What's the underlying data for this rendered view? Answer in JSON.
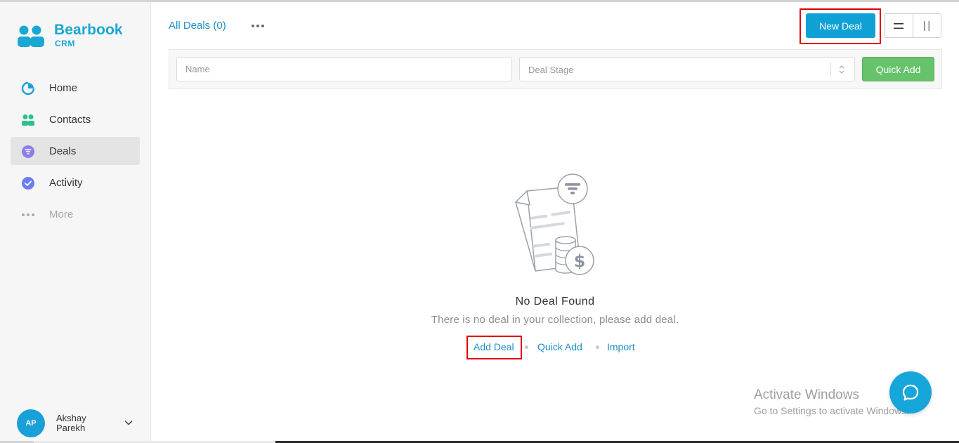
{
  "brand": {
    "name": "Bearbook",
    "sub": "CRM"
  },
  "sidebar": {
    "items": [
      {
        "label": "Home"
      },
      {
        "label": "Contacts"
      },
      {
        "label": "Deals"
      },
      {
        "label": "Activity"
      },
      {
        "label": "More"
      }
    ],
    "active": "Deals"
  },
  "user": {
    "initials": "AP",
    "first_name": "Akshay",
    "last_name": "Parekh"
  },
  "header": {
    "title": "All Deals (0)",
    "new_deal_label": "New Deal"
  },
  "filters": {
    "name_placeholder": "Name",
    "stage_placeholder": "Deal Stage",
    "quick_add_label": "Quick Add"
  },
  "empty_state": {
    "title": "No Deal Found",
    "description": "There is no deal in your collection, please add deal.",
    "actions": {
      "add": "Add Deal",
      "quick_add": "Quick Add",
      "import": "Import"
    }
  },
  "watermark": {
    "title": "Activate Windows",
    "subtitle": "Go to Settings to activate Windows."
  },
  "colors": {
    "brand": "#19a8d3",
    "primary_button": "#0fa1d6",
    "success_button": "#66c36b",
    "link": "#1a8fc4",
    "highlight": "#e00000"
  }
}
